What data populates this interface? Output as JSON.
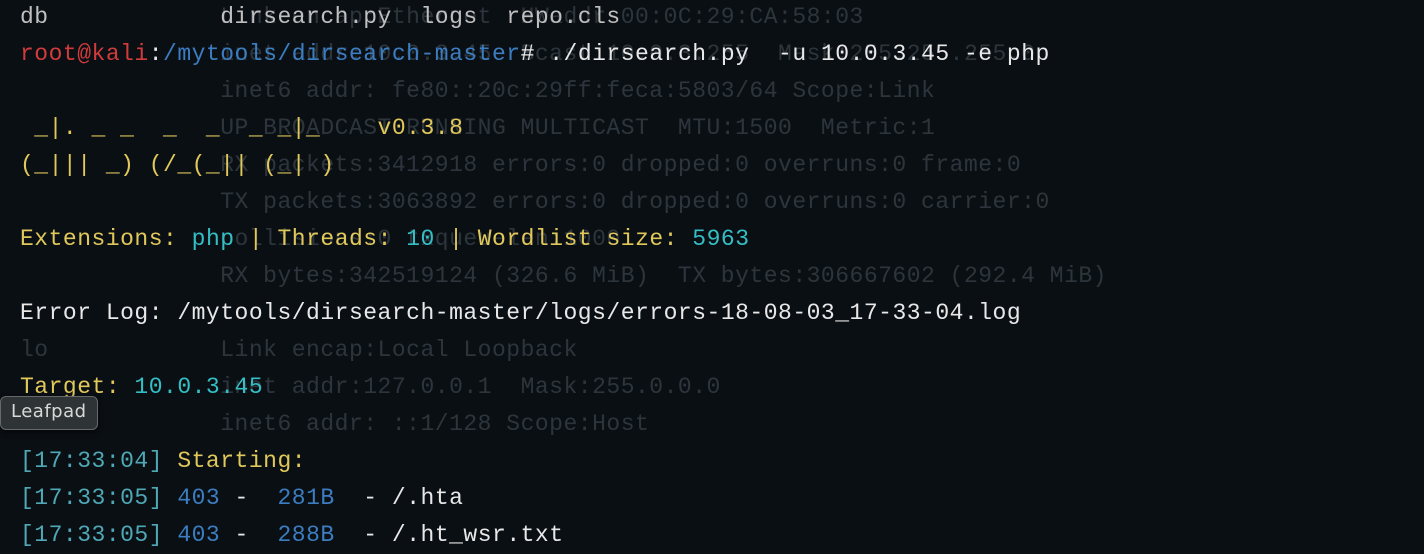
{
  "background": {
    "lines": [
      "              Link encap:Ethernet  HWaddr 00:0C:29:CA:58:03",
      "              inet addr:10.0.3.45  Bcast:10.0.3.255  Mask:255.255.255.0",
      "              inet6 addr: fe80::20c:29ff:feca:5803/64 Scope:Link",
      "              UP BROADCAST RUNNING MULTICAST  MTU:1500  Metric:1",
      "              RX packets:3412918 errors:0 dropped:0 overruns:0 frame:0",
      "              TX packets:3063892 errors:0 dropped:0 overruns:0 carrier:0",
      "              collisions:0 txqueuelen:1000",
      "              RX bytes:342519124 (326.6 MiB)  TX bytes:306667602 (292.4 MiB)",
      "",
      "lo            Link encap:Local Loopback",
      "              inet addr:127.0.0.1  Mask:255.0.0.0",
      "              inet6 addr: ::1/128 Scope:Host",
      "",
      "",
      ""
    ]
  },
  "prompt": {
    "top_dim": "db            dirsearch.py  logs  repo.cls",
    "user": "root@kali",
    "sep": ":",
    "path": "/mytools/dirsearch-master",
    "hash": "# ",
    "cmd": "./dirsearch.py  -u 10.0.3.45 -e php"
  },
  "banner": {
    "l1": " _|. _ _  _  _  _ _|_    v0.3.8",
    "l2": "(_||| _) (/_(_|| (_| )"
  },
  "params": {
    "ext_label": "Extensions: ",
    "ext_value": "php",
    "sep1": " | ",
    "threads_label": "Threads: ",
    "threads_value": "10",
    "sep2": " | ",
    "wl_label": "Wordlist size: ",
    "wl_value": "5963"
  },
  "errorlog": {
    "label": "Error Log: ",
    "path": "/mytools/dirsearch-master/logs/errors-18-08-03_17-33-04.log"
  },
  "target": {
    "label": "Target: ",
    "value": "10.0.3.45"
  },
  "starting": {
    "time": "[17:33:04] ",
    "label": "Starting:"
  },
  "results": [
    {
      "time": "[17:33:05] ",
      "code": "403",
      "dash": " -  ",
      "size": "281B",
      "dash2": "  - ",
      "path": "/.hta"
    },
    {
      "time": "[17:33:05] ",
      "code": "403",
      "dash": " -  ",
      "size": "288B",
      "dash2": "  - ",
      "path": "/.ht_wsr.txt"
    }
  ],
  "tooltip": "Leafpad"
}
